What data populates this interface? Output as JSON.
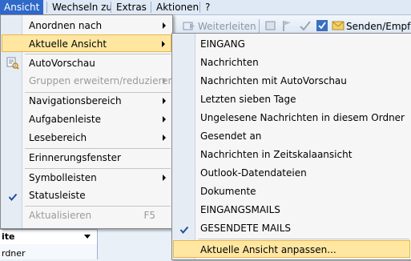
{
  "menubar": {
    "items": [
      "Ansicht",
      "Wechseln zu",
      "Extras",
      "Aktionen",
      "?"
    ]
  },
  "toolbar": {
    "forward_label": "Weiterleiten",
    "send_receive_label": "Senden/Empfan"
  },
  "left_pane": {
    "rows": [
      "ite",
      "rdner"
    ]
  },
  "view_menu": {
    "items": [
      {
        "label": "Anordnen nach",
        "submenu": true
      },
      {
        "label": "Aktuelle Ansicht",
        "submenu": true,
        "highlighted": true
      },
      {
        "label": "AutoVorschau",
        "icon": "autopreview-icon"
      },
      {
        "label": "Gruppen erweitern/reduzieren",
        "submenu": true,
        "disabled": true
      },
      {
        "label": "Navigationsbereich",
        "submenu": true
      },
      {
        "label": "Aufgabenleiste",
        "submenu": true
      },
      {
        "label": "Lesebereich",
        "submenu": true
      },
      {
        "label": "Erinnerungsfenster"
      },
      {
        "label": "Symbolleisten",
        "submenu": true
      },
      {
        "label": "Statusleiste",
        "checked": true
      },
      {
        "label": "Aktualisieren",
        "shortcut": "F5",
        "disabled": true
      }
    ]
  },
  "current_view_menu": {
    "items": [
      "EINGANG",
      "Nachrichten",
      "Nachrichten mit AutoVorschau",
      "Letzten sieben Tage",
      "Ungelesene Nachrichten in diesem Ordner",
      "Gesendet an",
      "Nachrichten in Zeitskalaansicht",
      "Outlook-Datendateien",
      "Dokumente",
      "EINGANGSMAILS",
      "GESENDETE MAILS",
      "Aktuelle Ansicht anpassen..."
    ],
    "checked_item": "GESENDETE MAILS",
    "highlighted_item": "Aktuelle Ansicht anpassen..."
  },
  "colors": {
    "menubar_active": "#2f69c9",
    "menu_highlight": "#ffe7a2",
    "menu_highlight_border": "#e8b64b",
    "check": "#1f4e9c"
  }
}
